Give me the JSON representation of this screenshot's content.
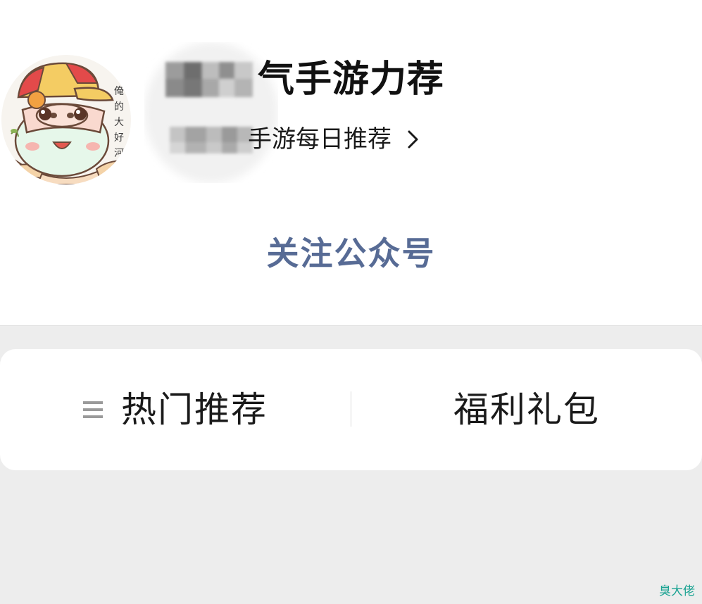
{
  "account": {
    "name": "气手游力荐",
    "description": "手游每日推荐"
  },
  "follow": {
    "label": "关注公众号"
  },
  "menu": {
    "items": [
      {
        "label": "热门推荐",
        "icon": "list-icon"
      },
      {
        "label": "福利礼包"
      }
    ]
  },
  "watermark": "臭大佬",
  "colors": {
    "link_blue": "#576b95",
    "watermark_teal": "#1aa392",
    "background_gray": "#ededed"
  }
}
